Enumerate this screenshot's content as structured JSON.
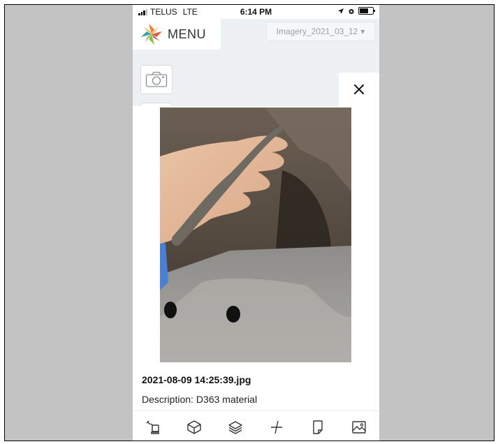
{
  "status_bar": {
    "carrier": "TELUS",
    "network": "LTE",
    "time": "6:14 PM"
  },
  "header": {
    "menu_label": "MENU",
    "imagery_select": "Imagery_2021_03_12",
    "logo_icon": "multicolor-star-logo"
  },
  "sidebar": {
    "camera_icon": "camera-icon"
  },
  "modal": {
    "close_icon": "close-icon",
    "photo_icon": "soil-sample-photo",
    "file_name": "2021-08-09 14:25:39.jpg",
    "description_label": "Description:",
    "description_value": "D363 material"
  },
  "toolbar": {
    "tools": [
      "shovel-icon",
      "cube-icon",
      "layers-icon",
      "measure-icon",
      "note-icon",
      "image-icon"
    ]
  },
  "colors": {
    "page_background": "#c3c3c3",
    "app_background": "#eef1f4",
    "text": "#111111",
    "muted_text": "#9aa0a6"
  }
}
